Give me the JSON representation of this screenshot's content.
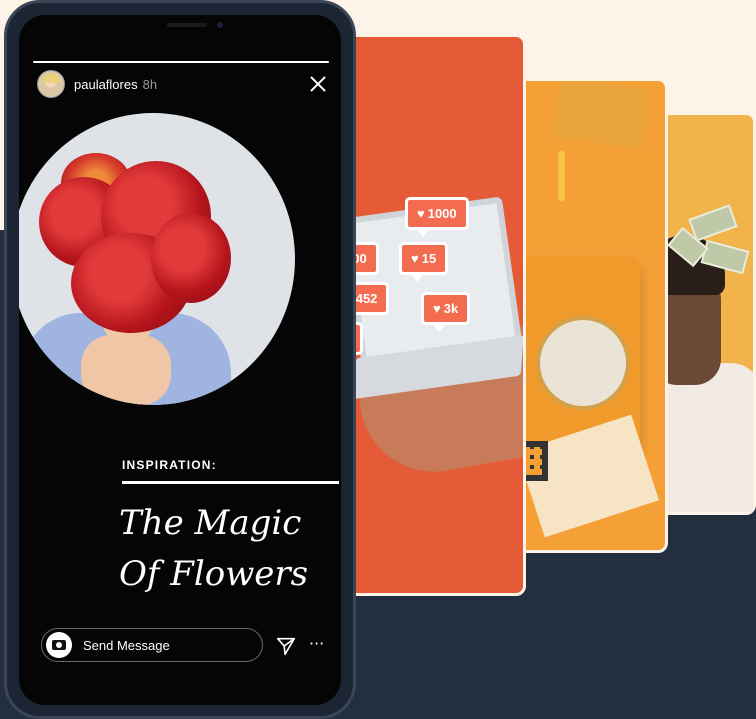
{
  "story": {
    "username": "paulaflores",
    "timestamp": "8h",
    "progress": 1.0,
    "kicker": "INSPIRATION:",
    "title": "The Magic\nOf Flowers",
    "message_placeholder": "Send Message"
  },
  "cards": {
    "notifications": [
      "1000",
      "100",
      "15",
      "452",
      "3k",
      "52"
    ]
  },
  "icons": {
    "close": "close-icon",
    "camera": "camera-icon",
    "send": "send-icon",
    "more": "more-icon",
    "heart": "heart-icon"
  },
  "colors": {
    "background_top": "#fdf3e8",
    "background_bottom": "#232f3e",
    "phone": "#1c2533",
    "card_red": "#e65b37",
    "card_orange": "#f5a037",
    "card_yellow": "#f1b34a"
  }
}
